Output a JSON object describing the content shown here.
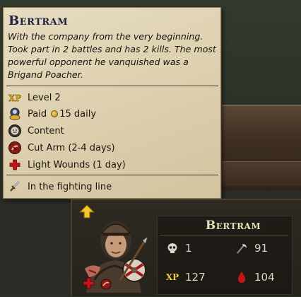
{
  "tooltip": {
    "title": "Bertram",
    "description": "With the company from the very beginning. Took part in 2 battles and has 2 kills. The most powerful opponent he vanquished was a Brigand Poacher.",
    "rows": [
      {
        "icon": "xp-icon",
        "label": "Level 2"
      },
      {
        "icon": "paid-icon",
        "label_prefix": "Paid",
        "label_suffix": "15 daily"
      },
      {
        "icon": "mood-content-icon",
        "label": "Content"
      },
      {
        "icon": "cut-arm-icon",
        "label": "Cut Arm (2-4 days)"
      },
      {
        "icon": "light-wounds-icon",
        "label": "Light Wounds (1 day)"
      }
    ],
    "position_row": {
      "icon": "sword-icon",
      "label": "In the fighting line"
    }
  },
  "character_panel": {
    "name": "Bertram",
    "stats": {
      "kills": "1",
      "kills_icon": "skull-icon",
      "fatigue": "91",
      "fatigue_icon": "scythe-icon",
      "xp_label": "XP",
      "xp": "127",
      "hitpoints": "104",
      "hitpoints_icon": "blood-drop-icon"
    },
    "level_up_icon": "arrow-up-icon"
  },
  "colors": {
    "parchment": "#e0d4b4",
    "title_ink": "#1d2244",
    "panel_bg": "#2a2620",
    "stat_text": "#d8d1bd",
    "xp_gold": "#f0c340",
    "blood_red": "#c4161a"
  }
}
